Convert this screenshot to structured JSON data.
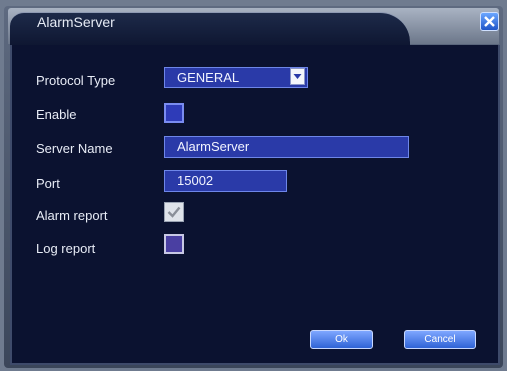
{
  "dialog": {
    "title": "AlarmServer"
  },
  "form": {
    "protocol_type_label": "Protocol Type",
    "protocol_type_value": "GENERAL",
    "enable_label": "Enable",
    "enable_checked": false,
    "server_name_label": "Server Name",
    "server_name_value": "AlarmServer",
    "port_label": "Port",
    "port_value": "15002",
    "alarm_report_label": "Alarm report",
    "alarm_report_checked": true,
    "log_report_label": "Log report",
    "log_report_checked": false
  },
  "buttons": {
    "ok_label": "Ok",
    "cancel_label": "Cancel"
  }
}
